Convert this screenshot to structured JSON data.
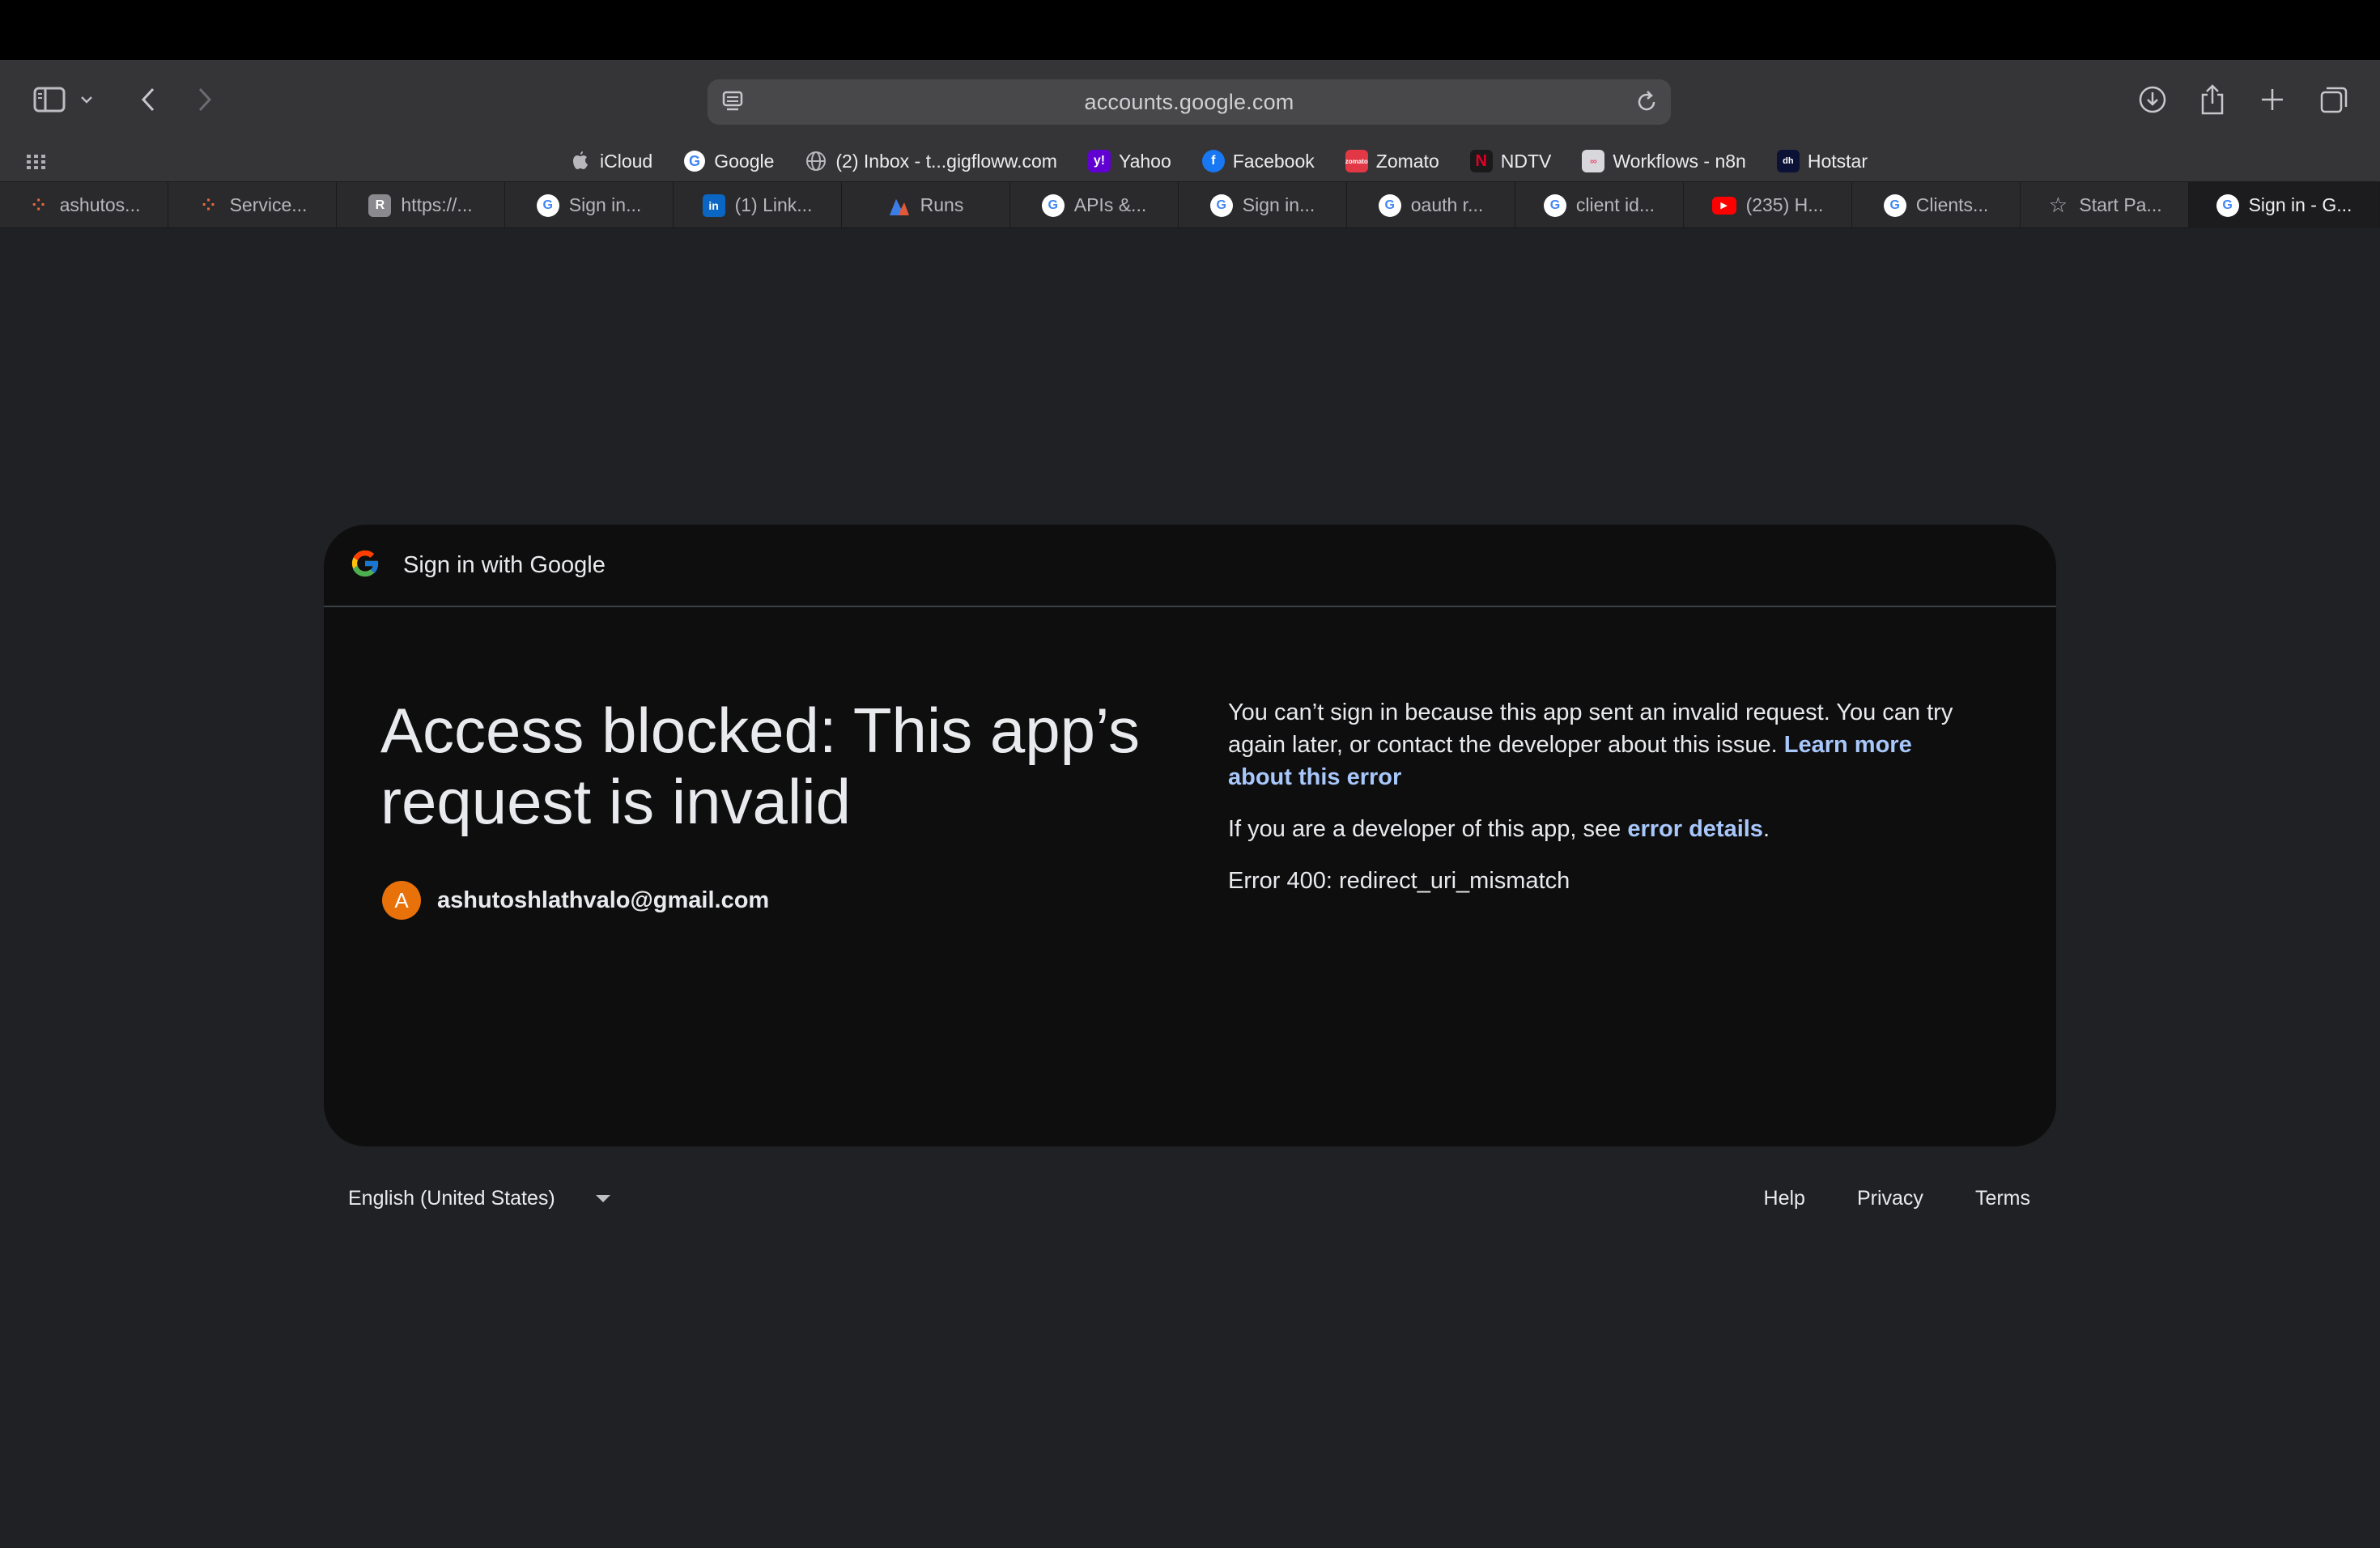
{
  "browser": {
    "address": "accounts.google.com",
    "icons": [
      "sidebar-icon",
      "chevron-down-icon",
      "back-icon",
      "forward-icon",
      "site-settings-icon",
      "reload-icon",
      "download-icon",
      "share-icon",
      "new-tab-icon",
      "tab-overview-icon"
    ]
  },
  "favorites": [
    {
      "label": "iCloud",
      "icon": "apple-icon"
    },
    {
      "label": "Google",
      "icon": "google-icon"
    },
    {
      "label": "(2) Inbox - t...gigfloww.com",
      "icon": "globe-icon"
    },
    {
      "label": "Yahoo",
      "icon": "yahoo-icon"
    },
    {
      "label": "Facebook",
      "icon": "facebook-icon"
    },
    {
      "label": "Zomato",
      "icon": "zomato-icon"
    },
    {
      "label": "NDTV",
      "icon": "ndtv-icon"
    },
    {
      "label": "Workflows - n8n",
      "icon": "n8n-icon"
    },
    {
      "label": "Hotstar",
      "icon": "hotstar-icon"
    }
  ],
  "tabs": [
    {
      "label": "ashutos...",
      "icon": "n8n-icon"
    },
    {
      "label": "Service...",
      "icon": "n8n-icon"
    },
    {
      "label": "https://...",
      "icon": "r-icon"
    },
    {
      "label": "Sign in...",
      "icon": "google-icon"
    },
    {
      "label": "(1) Link...",
      "icon": "linkedin-icon"
    },
    {
      "label": "Runs",
      "icon": "runs-icon"
    },
    {
      "label": "APIs &...",
      "icon": "google-icon"
    },
    {
      "label": "Sign in...",
      "icon": "google-icon"
    },
    {
      "label": "oauth r...",
      "icon": "google-icon"
    },
    {
      "label": "client id...",
      "icon": "google-icon"
    },
    {
      "label": "(235) H...",
      "icon": "youtube-icon"
    },
    {
      "label": "Clients...",
      "icon": "google-icon"
    },
    {
      "label": "Start Pa...",
      "icon": "star-icon"
    },
    {
      "label": "Sign in - G...",
      "icon": "google-icon",
      "active": true
    }
  ],
  "card": {
    "header_title": "Sign in with Google",
    "heading": "Access blocked: This app’s request is invalid",
    "account_initial": "A",
    "account_email": "ashutoshlathvalo@gmail.com",
    "para1_text": "You can’t sign in because this app sent an invalid request. You can try again later, or contact the developer about this issue. ",
    "para1_link": "Learn more about this error",
    "para2_text": "If you are a developer of this app, see ",
    "para2_link": "error details",
    "para2_end": ".",
    "error_code": "Error 400: redirect_uri_mismatch"
  },
  "footer": {
    "language": "English (United States)",
    "help": "Help",
    "privacy": "Privacy",
    "terms": "Terms"
  },
  "colors": {
    "link": "#a8c7fa",
    "avatar": "#e8710a",
    "card_bg": "#0e0e0f",
    "page_bg": "#202124"
  }
}
